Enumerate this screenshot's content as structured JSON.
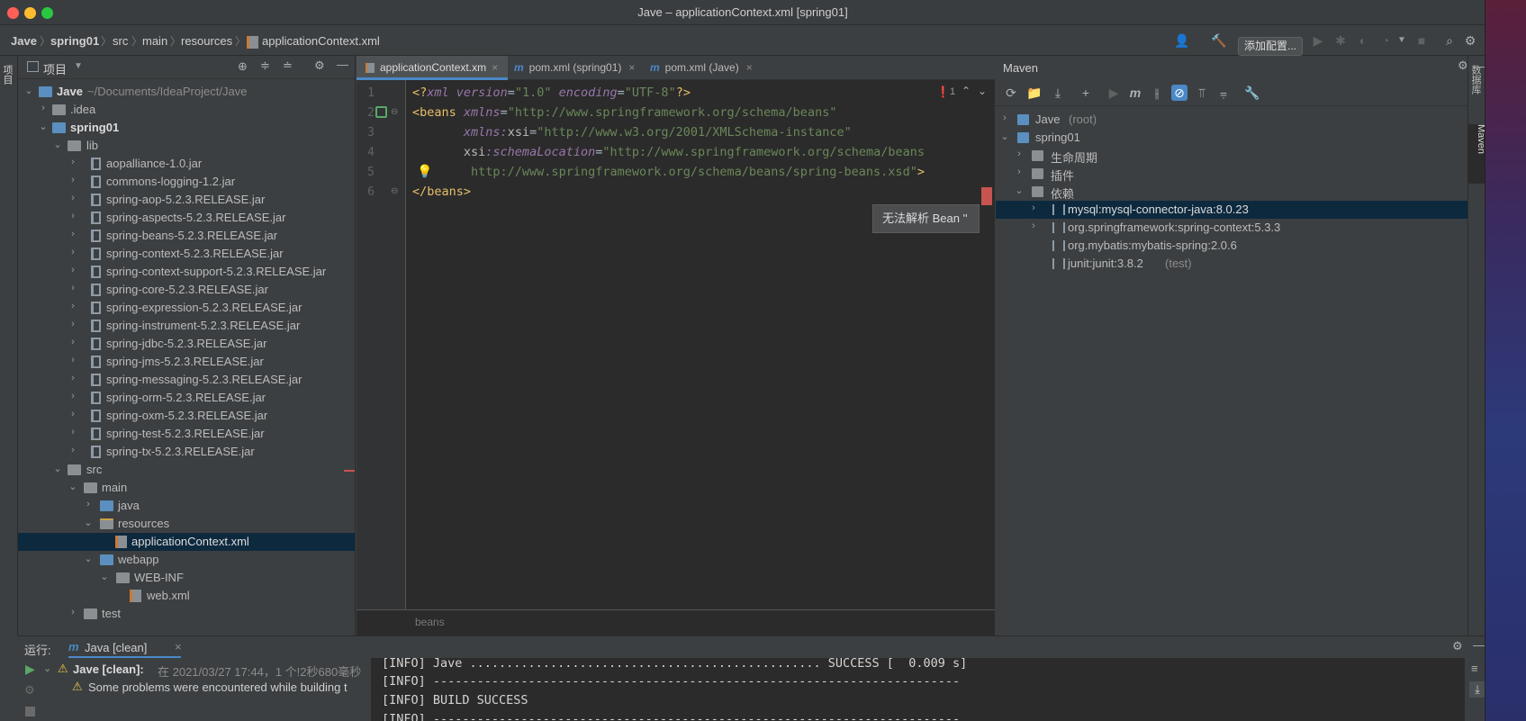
{
  "window": {
    "title": "Jave – applicationContext.xml [spring01]"
  },
  "breadcrumbs": [
    "Jave",
    "spring01",
    "src",
    "main",
    "resources",
    "applicationContext.xml"
  ],
  "toolbar": {
    "add_config_label": "添加配置..."
  },
  "left_strip": {
    "project_label": "项目"
  },
  "right_strip": {
    "database_label": "数据库",
    "maven_label": "Maven"
  },
  "project": {
    "header_label": "项目",
    "root": {
      "name": "Jave",
      "path": "~/Documents/IdeaProject/Jave"
    },
    "items": [
      {
        "label": ".idea"
      },
      {
        "label": "spring01"
      },
      {
        "label": "lib"
      },
      {
        "label": "aopalliance-1.0.jar"
      },
      {
        "label": "commons-logging-1.2.jar"
      },
      {
        "label": "spring-aop-5.2.3.RELEASE.jar"
      },
      {
        "label": "spring-aspects-5.2.3.RELEASE.jar"
      },
      {
        "label": "spring-beans-5.2.3.RELEASE.jar"
      },
      {
        "label": "spring-context-5.2.3.RELEASE.jar"
      },
      {
        "label": "spring-context-support-5.2.3.RELEASE.jar"
      },
      {
        "label": "spring-core-5.2.3.RELEASE.jar"
      },
      {
        "label": "spring-expression-5.2.3.RELEASE.jar"
      },
      {
        "label": "spring-instrument-5.2.3.RELEASE.jar"
      },
      {
        "label": "spring-jdbc-5.2.3.RELEASE.jar"
      },
      {
        "label": "spring-jms-5.2.3.RELEASE.jar"
      },
      {
        "label": "spring-messaging-5.2.3.RELEASE.jar"
      },
      {
        "label": "spring-orm-5.2.3.RELEASE.jar"
      },
      {
        "label": "spring-oxm-5.2.3.RELEASE.jar"
      },
      {
        "label": "spring-test-5.2.3.RELEASE.jar"
      },
      {
        "label": "spring-tx-5.2.3.RELEASE.jar"
      },
      {
        "label": "src"
      },
      {
        "label": "main"
      },
      {
        "label": "java"
      },
      {
        "label": "resources"
      },
      {
        "label": "applicationContext.xml"
      },
      {
        "label": "webapp"
      },
      {
        "label": "WEB-INF"
      },
      {
        "label": "web.xml"
      },
      {
        "label": "test"
      }
    ]
  },
  "editor": {
    "tabs": [
      {
        "label": "applicationContext.xm"
      },
      {
        "label": "pom.xml (spring01)"
      },
      {
        "label": "pom.xml (Jave)"
      }
    ],
    "error_count": "1",
    "line_numbers": [
      "1",
      "2",
      "3",
      "4",
      "5",
      "6"
    ],
    "code": {
      "l1_open": "<?",
      "l1_tag": "xml",
      "l1_a1": "version",
      "l1_v1": "\"1.0\"",
      "l1_a2": "encoding",
      "l1_v2": "\"UTF-8\"",
      "l1_close": "?>",
      "l2_open": "<",
      "l2_tag": "beans",
      "l2_attr": "xmlns",
      "l2_val": "\"http://www.springframework.org/schema/beans\"",
      "l3_ns": "xmlns:",
      "l3_attr": "xsi",
      "l3_val": "\"http://www.w3.org/2001/XMLSchema-instance\"",
      "l4_ns": "xsi",
      "l4_attr": ":schemaLocation",
      "l4_val": "\"http://www.springframework.org/schema/beans",
      "l5_val": "http://www.springframework.org/schema/beans/spring-beans.xsd\"",
      "l5_close": ">",
      "l6_open": "</",
      "l6_tag": "beans",
      "l6_close": ">"
    },
    "tooltip": "无法解析 Bean ''",
    "breadcrumb_footer": "beans"
  },
  "maven": {
    "title": "Maven",
    "tree": [
      {
        "label": "Jave",
        "suffix": "(root)"
      },
      {
        "label": "spring01",
        "suffix": ""
      },
      {
        "label": "生命周期",
        "suffix": ""
      },
      {
        "label": "插件",
        "suffix": ""
      },
      {
        "label": "依赖",
        "suffix": ""
      },
      {
        "label": "mysql:mysql-connector-java:8.0.23",
        "suffix": ""
      },
      {
        "label": "org.springframework:spring-context:5.3.3",
        "suffix": ""
      },
      {
        "label": "org.mybatis:mybatis-spring:2.0.6",
        "suffix": ""
      },
      {
        "label": "junit:junit:3.8.2",
        "suffix": "(test)"
      }
    ]
  },
  "run": {
    "label": "运行:",
    "tab_label": "Java [clean]",
    "entry_title": "Jave [clean]:",
    "entry_detail": "在 2021/03/27 17:44，1 个!2秒680毫秒",
    "warning": "Some problems were encountered while building t",
    "console": [
      "[INFO] Jave ................................................ SUCCESS [  0.009 s]",
      "[INFO] ------------------------------------------------------------------------",
      "[INFO] BUILD SUCCESS",
      "[INFO] ------------------------------------------------------------------------"
    ]
  },
  "colors": {
    "selection": "#0d293e",
    "accent": "#4a88c7",
    "error": "#c75450",
    "xml_tag": "#e8bf6a",
    "xml_value": "#6a8759",
    "xml_namespace": "#9876aa"
  }
}
